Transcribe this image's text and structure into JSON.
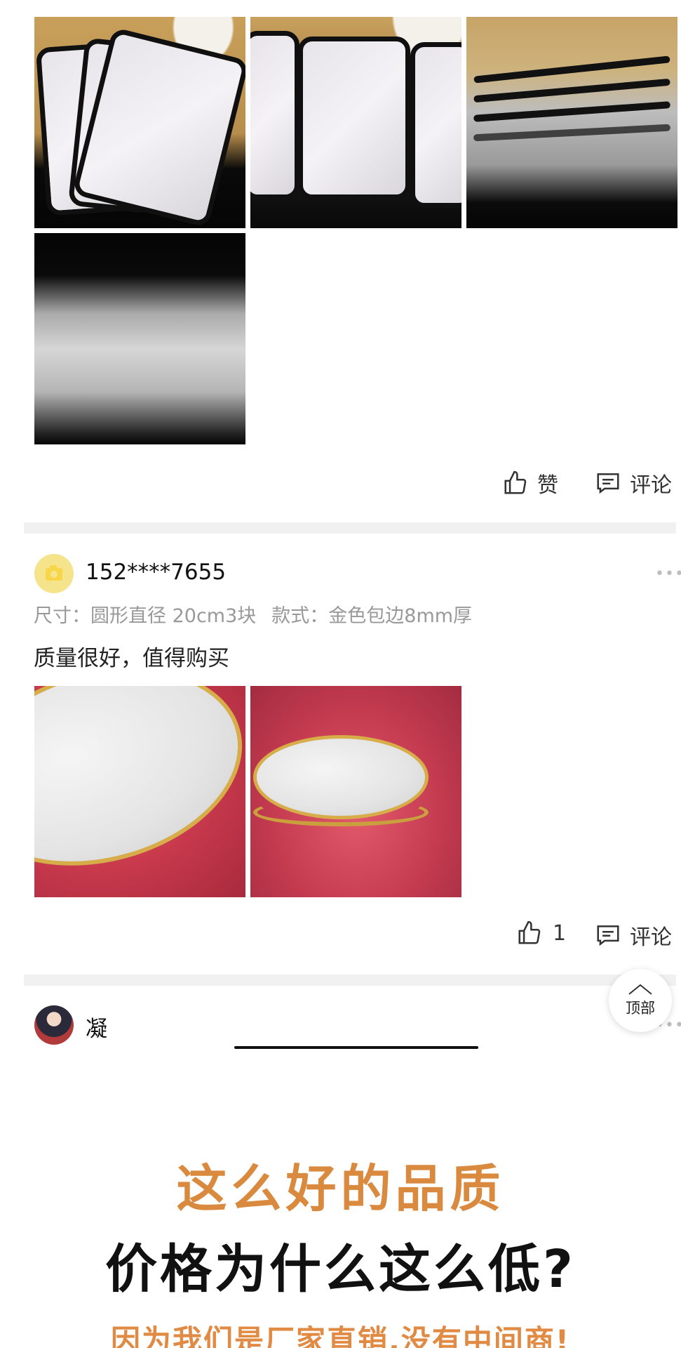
{
  "review_1": {
    "like_label": "赞",
    "comment_label": "评论"
  },
  "review_2": {
    "username": "152****7655",
    "spec_size": "尺寸：圆形直径 20cm3块",
    "spec_style": "款式：金色包边8mm厚",
    "comment": "质量很好，值得购买",
    "like_count": "1",
    "comment_label": "评论"
  },
  "review_3": {
    "username": "凝"
  },
  "back_to_top_label": "顶部",
  "promo": {
    "line1": "这么好的品质",
    "line2": "价格为什么这么低?",
    "line3": "因为我们是厂家直销,没有中间商!"
  },
  "colors": {
    "promo_orange": "#d98a3e",
    "divider": "#f1f1f1",
    "meta_gray": "#999999",
    "gold_rim": "#d6ad49"
  },
  "icons": {
    "like": "thumbs-up-icon",
    "comment": "comment-icon",
    "more": "more-dots-icon",
    "back_to_top": "chevron-up-icon",
    "avatar_camera": "camera-icon"
  }
}
